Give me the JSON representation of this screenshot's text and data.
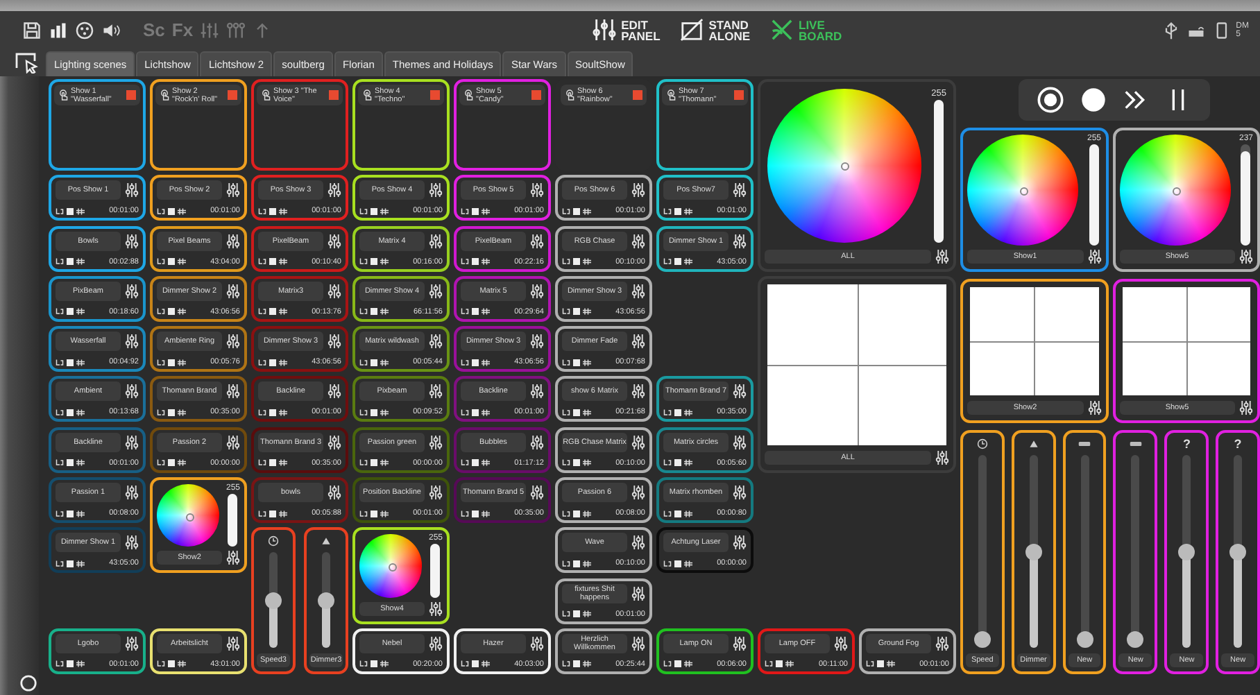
{
  "toolbar_labels": [
    "Sc",
    "Fx"
  ],
  "modes": [
    {
      "label": "EDIT PANEL",
      "selected": false
    },
    {
      "label": "STAND ALONE",
      "selected": false
    },
    {
      "label": "LIVE BOARD",
      "selected": true
    }
  ],
  "status_text": [
    "DM",
    "5"
  ],
  "tabs": [
    {
      "label": "Lighting scenes",
      "selected": true
    },
    {
      "label": "Lichtshow",
      "selected": false
    },
    {
      "label": "Lichtshow 2",
      "selected": false
    },
    {
      "label": "soultberg",
      "selected": false
    },
    {
      "label": "Florian",
      "selected": false
    },
    {
      "label": "Themes and Holidays",
      "selected": false
    },
    {
      "label": "Star Wars",
      "selected": false
    },
    {
      "label": "SoultShow",
      "selected": false
    }
  ],
  "columns": [
    {
      "show": {
        "label": "Show 1 \"Wasserfall\"",
        "color": "#1ea7e6"
      },
      "slots": [
        {
          "kind": "cue",
          "label": "Pos Show 1",
          "time": "00:01:00",
          "color": "#1ea7e6"
        },
        {
          "kind": "cue",
          "label": "Bowls",
          "time": "00:02:88",
          "color": "#1ea7e6"
        },
        {
          "kind": "cue",
          "label": "PixBeam",
          "time": "00:18:60",
          "color": "#1a95cc"
        },
        {
          "kind": "cue",
          "label": "Wasserfall",
          "time": "00:04:92",
          "color": "#1a88bb"
        },
        {
          "kind": "cue",
          "label": "Ambient",
          "time": "00:13:68",
          "color": "#1a6f9a"
        },
        {
          "kind": "cue",
          "label": "Backline",
          "time": "00:01:00",
          "color": "#175f85"
        },
        {
          "kind": "cue",
          "label": "Passion 1",
          "time": "00:08:00",
          "color": "#144e6e"
        },
        {
          "kind": "cue",
          "label": "Dimmer Show 1",
          "time": "43:05:00",
          "color": "#123e58"
        },
        {
          "kind": "empty"
        },
        {
          "kind": "cue",
          "label": "Lgobo",
          "time": "00:01:00",
          "color": "#18b08a"
        }
      ]
    },
    {
      "show": {
        "label": "Show 2 \"Rock'n' Roll\"",
        "color": "#f0a020"
      },
      "slots": [
        {
          "kind": "cue",
          "label": "Pos Show 2",
          "time": "00:01:00",
          "color": "#f0a020"
        },
        {
          "kind": "cue",
          "label": "Pixel Beams",
          "time": "43:04:00",
          "color": "#e09a1c"
        },
        {
          "kind": "cue",
          "label": "Dimmer Show 2",
          "time": "43:06:56",
          "color": "#c88418"
        },
        {
          "kind": "cue",
          "label": "Ambiente Ring",
          "time": "00:05:76",
          "color": "#b07414"
        },
        {
          "kind": "cue",
          "label": "Thomann Brand",
          "time": "00:35:00",
          "color": "#8a5a10"
        },
        {
          "kind": "cue",
          "label": "Passion 2",
          "time": "00:00:00",
          "color": "#704a0c"
        },
        {
          "kind": "color",
          "label": "Show2",
          "value": "255",
          "level": 1,
          "color": "#f0a020"
        },
        {
          "kind": "empty"
        },
        {
          "kind": "cue",
          "label": "Arbeitslicht",
          "time": "43:01:00",
          "color": "#e8e070"
        }
      ]
    },
    {
      "show": {
        "label": "Show 3 \"The Voice\"",
        "color": "#e02020"
      },
      "slots": [
        {
          "kind": "cue",
          "label": "Pos Show 3",
          "time": "00:01:00",
          "color": "#e02020"
        },
        {
          "kind": "cue",
          "label": "PixelBeam",
          "time": "00:10:40",
          "color": "#cc1a1a"
        },
        {
          "kind": "cue",
          "label": "Matrix3",
          "time": "00:13:76",
          "color": "#a81414"
        },
        {
          "kind": "cue",
          "label": "Dimmer Show 3",
          "time": "43:06:56",
          "color": "#8a1010"
        },
        {
          "kind": "cue",
          "label": "Backline",
          "time": "00:01:00",
          "color": "#6e0e0e"
        },
        {
          "kind": "cue",
          "label": "Thomann Brand 3",
          "time": "00:35:00",
          "color": "#5a0c0c"
        },
        {
          "kind": "cue",
          "label": "bowls",
          "time": "00:05:88",
          "color": "#7a1414"
        },
        {
          "kind": "faders",
          "color": "#e84020",
          "faders": [
            {
              "kind": "clock",
              "label": "Speed3",
              "level": 0.5
            },
            {
              "kind": "triangle",
              "label": "Dimmer3",
              "level": 0.5
            }
          ]
        }
      ]
    },
    {
      "show": {
        "label": "Show 4 \"Techno\"",
        "color": "#a8e020"
      },
      "slots": [
        {
          "kind": "cue",
          "label": "Pos Show 4",
          "time": "00:01:00",
          "color": "#a8e020"
        },
        {
          "kind": "cue",
          "label": "Matrix 4",
          "time": "00:16:00",
          "color": "#98d020"
        },
        {
          "kind": "cue",
          "label": "Dimmer Show 4",
          "time": "66:11:56",
          "color": "#88b818"
        },
        {
          "kind": "cue",
          "label": "Matrix wildwash",
          "time": "00:05:44",
          "color": "#6a9414"
        },
        {
          "kind": "cue",
          "label": "Pixbeam",
          "time": "00:09:52",
          "color": "#5a7c10"
        },
        {
          "kind": "cue",
          "label": "Passion green",
          "time": "00:00:00",
          "color": "#4a660c"
        },
        {
          "kind": "cue",
          "label": "Position Backline",
          "time": "00:01:00",
          "color": "#3e540a"
        },
        {
          "kind": "color",
          "label": "Show4",
          "value": "255",
          "level": 1,
          "color": "#a8e020"
        },
        {
          "kind": "cue",
          "label": "Nebel",
          "time": "00:20:00",
          "color": "#f0f0f0"
        }
      ]
    },
    {
      "show": {
        "label": "Show 5 \"Candy\"",
        "color": "#e020e0"
      },
      "slots": [
        {
          "kind": "cue",
          "label": "Pos Show 5",
          "time": "00:01:00",
          "color": "#e020e0"
        },
        {
          "kind": "cue",
          "label": "PixelBeam",
          "time": "00:22:16",
          "color": "#d018d0"
        },
        {
          "kind": "cue",
          "label": "Matrix 5",
          "time": "00:29:64",
          "color": "#b014b0"
        },
        {
          "kind": "cue",
          "label": "Dimmer Show 3",
          "time": "43:06:56",
          "color": "#9a109a"
        },
        {
          "kind": "cue",
          "label": "Backline",
          "time": "00:01:00",
          "color": "#801080"
        },
        {
          "kind": "cue",
          "label": "Bubbles",
          "time": "01:17:12",
          "color": "#6a0c6a"
        },
        {
          "kind": "cue",
          "label": "Thomann Brand 5",
          "time": "00:35:00",
          "color": "#560a56"
        },
        {
          "kind": "empty"
        },
        {
          "kind": "empty"
        },
        {
          "kind": "cue",
          "label": "Hazer",
          "time": "40:03:00",
          "color": "#f0f0f0"
        }
      ]
    },
    {
      "show": {
        "label": "Show 6 \"Rainbow\""
      },
      "slots": [
        {
          "kind": "cue",
          "label": "Pos Show 6",
          "time": "00:01:00",
          "color": "#b0b0b0"
        },
        {
          "kind": "cue",
          "label": "RGB Chase",
          "time": "00:10:00",
          "color": "#b0b0b0"
        },
        {
          "kind": "cue",
          "label": "Dimmer Show 3",
          "time": "43:06:56",
          "color": "#b0b0b0"
        },
        {
          "kind": "cue",
          "label": "Dimmer Fade",
          "time": "00:07:68",
          "color": "#b0b0b0"
        },
        {
          "kind": "cue",
          "label": "show 6 Matrix",
          "time": "00:21:68",
          "color": "#b0b0b0"
        },
        {
          "kind": "cue",
          "label": "RGB Chase Matrix",
          "time": "00:10:00",
          "color": "#b0b0b0"
        },
        {
          "kind": "cue",
          "label": "Passion 6",
          "time": "00:08:00",
          "color": "#b0b0b0"
        },
        {
          "kind": "cue",
          "label": "Wave",
          "time": "00:10:00",
          "color": "#b0b0b0"
        },
        {
          "kind": "cue",
          "label": "fixtures  Shit happens",
          "time": "00:01:00",
          "color": "#b0b0b0"
        },
        {
          "kind": "cue",
          "label": "Herzlich Willkommen",
          "time": "00:25:44",
          "color": "#b0b0b0"
        }
      ]
    },
    {
      "show": {
        "label": "Show 7 \"Thomann\"",
        "color": "#20c0c8"
      },
      "slots": [
        {
          "kind": "cue",
          "label": "Pos Show7",
          "time": "00:01:00",
          "color": "#20c0c8"
        },
        {
          "kind": "cue",
          "label": "Dimmer Show 1",
          "time": "43:05:00",
          "color": "#20b4bc"
        },
        {
          "kind": "empty"
        },
        {
          "kind": "empty"
        },
        {
          "kind": "cue",
          "label": "Thomann Brand 7",
          "time": "00:35:00",
          "color": "#1a9aa0"
        },
        {
          "kind": "cue",
          "label": "Matrix circles",
          "time": "00:05:60",
          "color": "#188890"
        },
        {
          "kind": "cue",
          "label": "Matrix rhomben",
          "time": "00:00:80",
          "color": "#147a80"
        },
        {
          "kind": "cue",
          "label": "Achtung Laser",
          "time": "00:00:00",
          "color": "#0c0c0c"
        },
        {
          "kind": "empty"
        },
        {
          "kind": "cue",
          "label": "Lamp ON",
          "time": "00:06:00",
          "color": "#20c020"
        }
      ]
    }
  ],
  "master": {
    "wheel": {
      "label": "ALL",
      "value": "255",
      "level": 1
    },
    "pad": {
      "label": "ALL"
    },
    "cues": [
      {
        "label": "Lamp OFF",
        "time": "00:11:00",
        "color": "#e01818"
      },
      {
        "label": "Ground Fog",
        "time": "00:01:00",
        "color": "#b0b0b0"
      }
    ]
  },
  "transport": [
    {
      "kind": "record"
    },
    {
      "kind": "play"
    },
    {
      "kind": "forward"
    },
    {
      "kind": "pause"
    }
  ],
  "group_wheels": [
    {
      "label": "Show1",
      "value": "255",
      "level": 1,
      "color": "#1e8ee6"
    },
    {
      "label": "Show5",
      "value": "237",
      "level": 0.93,
      "color": "#b0b0b0"
    }
  ],
  "group_pads": [
    {
      "label": "Show2",
      "color": "#f0a020"
    },
    {
      "label": "Show5",
      "color": "#e020e0"
    }
  ],
  "group_faders": [
    {
      "kind": "clock",
      "label": "Speed",
      "level": 0,
      "color": "#f0a020"
    },
    {
      "kind": "triangle",
      "label": "Dimmer",
      "level": 0.5,
      "color": "#f0a020"
    },
    {
      "kind": "dmx",
      "label": "New",
      "level": 0,
      "color": "#f0a020"
    },
    {
      "kind": "dmx",
      "label": "New",
      "level": 0,
      "color": "#e020e0"
    },
    {
      "kind": "text",
      "glyph": "?",
      "label": "New",
      "level": 0.5,
      "color": "#e020e0"
    },
    {
      "kind": "text",
      "glyph": "?",
      "label": "New",
      "level": 0.5,
      "color": "#e020e0"
    }
  ]
}
